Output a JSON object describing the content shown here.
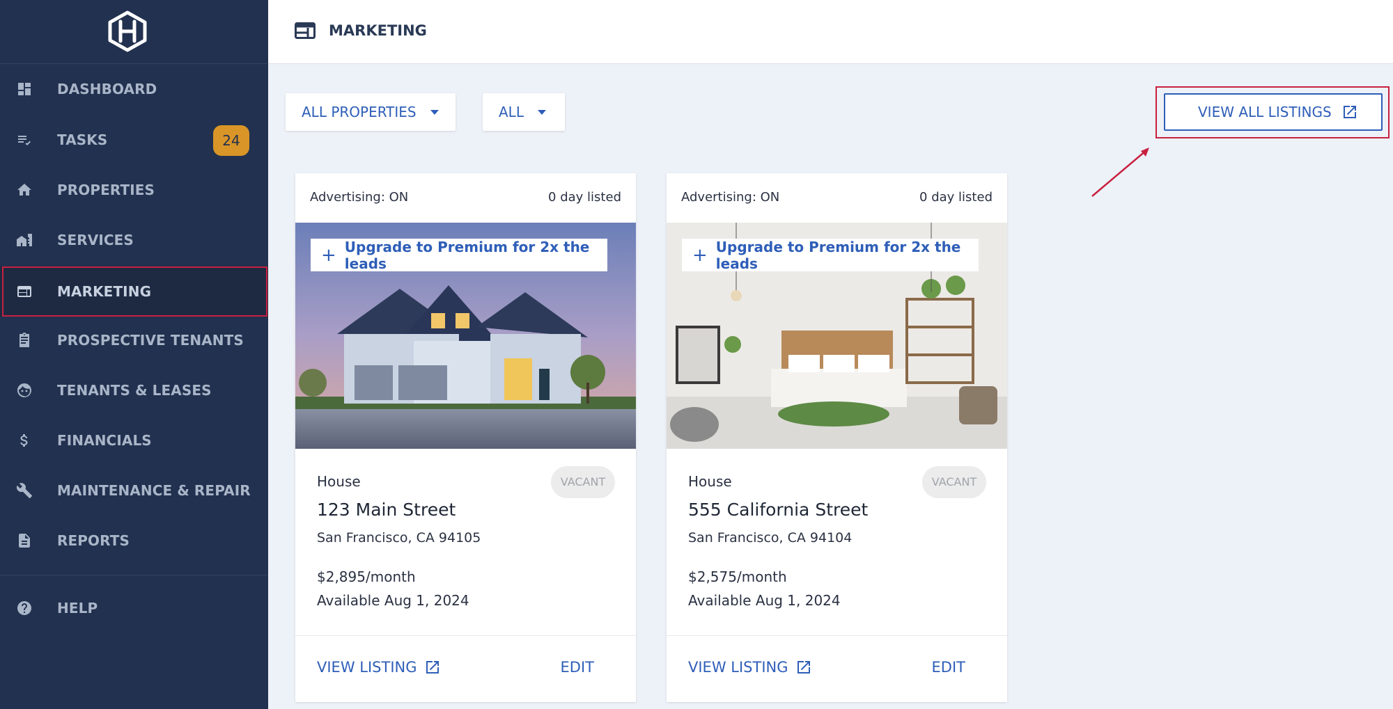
{
  "sidebar": {
    "items": [
      {
        "label": "DASHBOARD",
        "icon": "dashboard-icon"
      },
      {
        "label": "TASKS",
        "icon": "tasks-icon",
        "badge": "24"
      },
      {
        "label": "PROPERTIES",
        "icon": "home-icon"
      },
      {
        "label": "SERVICES",
        "icon": "services-icon"
      },
      {
        "label": "MARKETING",
        "icon": "marketing-icon",
        "active": true
      },
      {
        "label": "PROSPECTIVE TENANTS",
        "icon": "clipboard-icon"
      },
      {
        "label": "TENANTS & LEASES",
        "icon": "face-icon"
      },
      {
        "label": "FINANCIALS",
        "icon": "dollar-icon"
      },
      {
        "label": "MAINTENANCE & REPAIR",
        "icon": "wrench-icon"
      },
      {
        "label": "REPORTS",
        "icon": "document-icon"
      },
      {
        "label": "HELP",
        "icon": "help-icon"
      }
    ]
  },
  "header": {
    "title": "MARKETING"
  },
  "filters": {
    "properties": "ALL PROPERTIES",
    "status": "ALL"
  },
  "view_all": {
    "label": "VIEW ALL LISTINGS"
  },
  "listings": [
    {
      "advertising": "Advertising: ON",
      "listed": "0 day listed",
      "upgrade": "Upgrade to Premium for 2x the leads",
      "type": "House",
      "status": "VACANT",
      "address": "123 Main Street",
      "city": "San Francisco, CA 94105",
      "price": "$2,895/month",
      "available": "Available Aug 1, 2024",
      "view_label": "VIEW LISTING",
      "edit_label": "EDIT"
    },
    {
      "advertising": "Advertising: ON",
      "listed": "0 day listed",
      "upgrade": "Upgrade to Premium for 2x the leads",
      "type": "House",
      "status": "VACANT",
      "address": "555 California Street",
      "city": "San Francisco, CA 94104",
      "price": "$2,575/month",
      "available": "Available Aug 1, 2024",
      "view_label": "VIEW LISTING",
      "edit_label": "EDIT"
    }
  ],
  "colors": {
    "sidebar": "#22314f",
    "accent": "#2e5eb8",
    "highlight": "#c8203f",
    "badge": "#d99527"
  }
}
